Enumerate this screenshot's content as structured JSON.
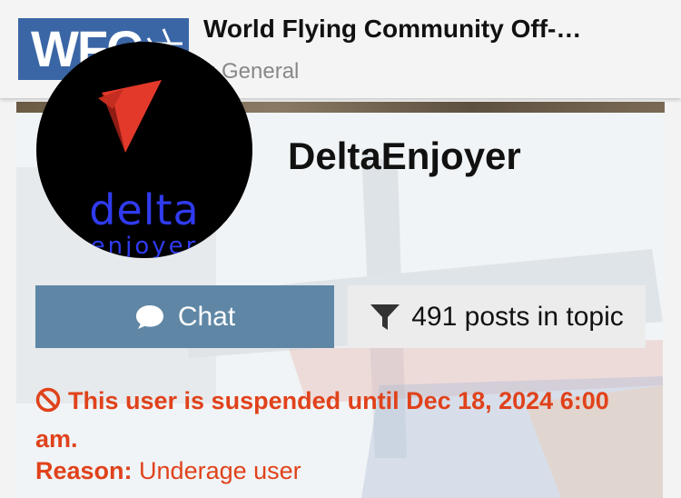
{
  "header": {
    "logo_text": "WFC",
    "topic_title": "World Flying Community Off-…",
    "category": "General"
  },
  "avatar": {
    "word": "delta",
    "subword": "enjoyer"
  },
  "profile": {
    "username": "DeltaEnjoyer"
  },
  "actions": {
    "chat_label": "Chat",
    "posts_label": "491 posts in topic"
  },
  "suspension": {
    "message": "This user is suspended until Dec 18, 2024 6:00 am.",
    "reason_label": "Reason:",
    "reason_value": "Underage user"
  },
  "icons": {
    "chat": "chat-bubble-icon",
    "filter": "filter-icon",
    "suspended": "ban-icon",
    "logo_plane": "airplane-icon"
  },
  "colors": {
    "accent": "#5f87a5",
    "danger": "#e0421b",
    "logo_blue": "#3b66a6",
    "avatar_text": "#2f3bf0",
    "avatar_delta": "#e2392b"
  }
}
